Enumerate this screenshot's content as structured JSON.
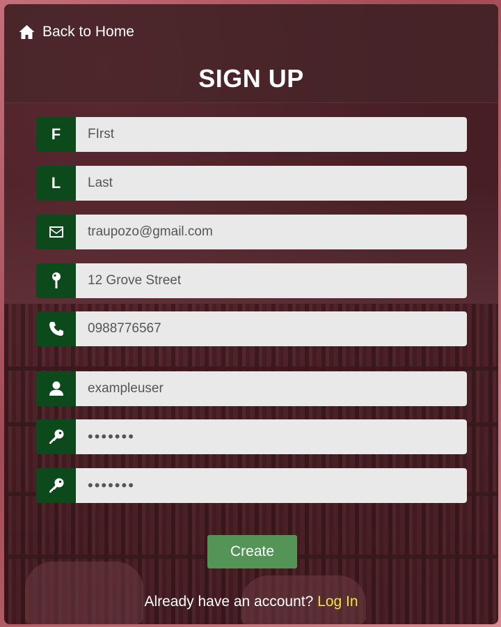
{
  "nav": {
    "back_label": "Back to Home",
    "back_icon": "home-icon"
  },
  "form": {
    "title": "SIGN UP",
    "first": {
      "icon_text": "F",
      "value": "FIrst"
    },
    "last": {
      "icon_text": "L",
      "value": "Last"
    },
    "email": {
      "icon": "envelope-icon",
      "value": "traupozo@gmail.com"
    },
    "address": {
      "icon": "map-pin-icon",
      "value": "12 Grove Street"
    },
    "phone": {
      "icon": "phone-icon",
      "value": "0988776567"
    },
    "username": {
      "icon": "user-icon",
      "value": "exampleuser"
    },
    "password": {
      "icon": "key-icon",
      "value": "•••••••"
    },
    "confirm_password": {
      "icon": "key-icon",
      "value": "•••••••"
    },
    "submit_label": "Create"
  },
  "footer": {
    "prompt": "Already have an account?",
    "login_label": "Log In"
  },
  "colors": {
    "icon_bg": "#0d4a1b",
    "button_bg": "#549456",
    "link": "#f2e24a"
  }
}
